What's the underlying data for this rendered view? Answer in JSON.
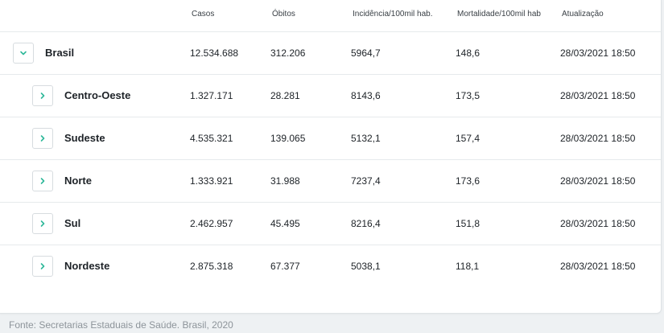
{
  "table": {
    "headers": [
      "Casos",
      "Óbitos",
      "Incidência/100mil hab.",
      "Mortalidade/100mil hab",
      "Atualização"
    ],
    "rows": [
      {
        "name": "Brasil",
        "casos": "12.534.688",
        "obitos": "312.206",
        "incidencia": "5964,7",
        "mortalidade": "148,6",
        "atualizacao": "28/03/2021 18:50",
        "expanded": true
      },
      {
        "name": "Centro-Oeste",
        "casos": "1.327.171",
        "obitos": "28.281",
        "incidencia": "8143,6",
        "mortalidade": "173,5",
        "atualizacao": "28/03/2021 18:50",
        "expanded": false
      },
      {
        "name": "Sudeste",
        "casos": "4.535.321",
        "obitos": "139.065",
        "incidencia": "5132,1",
        "mortalidade": "157,4",
        "atualizacao": "28/03/2021 18:50",
        "expanded": false
      },
      {
        "name": "Norte",
        "casos": "1.333.921",
        "obitos": "31.988",
        "incidencia": "7237,4",
        "mortalidade": "173,6",
        "atualizacao": "28/03/2021 18:50",
        "expanded": false
      },
      {
        "name": "Sul",
        "casos": "2.462.957",
        "obitos": "45.495",
        "incidencia": "8216,4",
        "mortalidade": "151,8",
        "atualizacao": "28/03/2021 18:50",
        "expanded": false
      },
      {
        "name": "Nordeste",
        "casos": "2.875.318",
        "obitos": "67.377",
        "incidencia": "5038,1",
        "mortalidade": "118,1",
        "atualizacao": "28/03/2021 18:50",
        "expanded": false
      }
    ]
  },
  "footer": {
    "source": "Fonte: Secretarias Estaduais de Saúde. Brasil, 2020"
  },
  "colors": {
    "accent": "#2fb89a",
    "border": "#e6eaec",
    "footer_text": "#8d949a"
  },
  "icons": {
    "expanded": "chevron-down-icon",
    "collapsed": "chevron-right-icon"
  }
}
